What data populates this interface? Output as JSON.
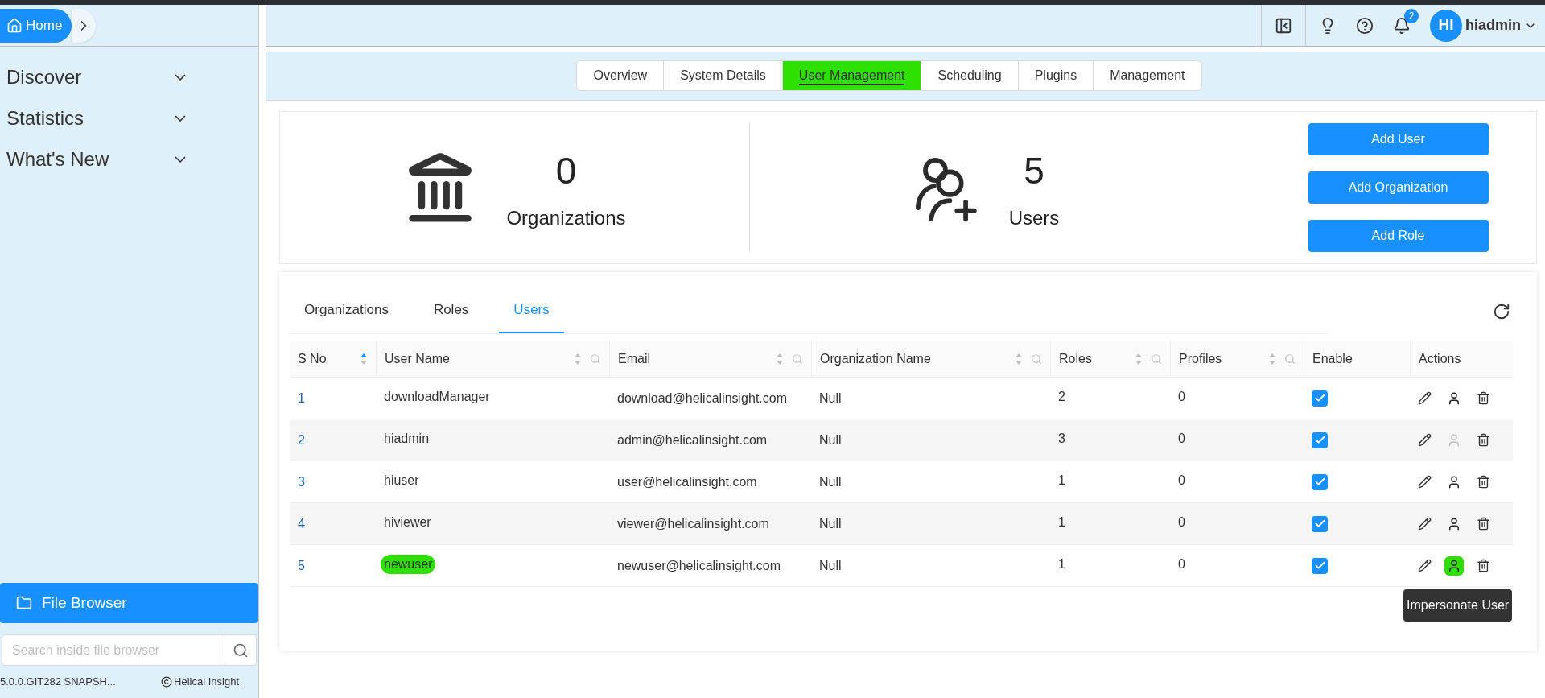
{
  "sidebar": {
    "home": "Home",
    "menu": [
      {
        "label": "Discover",
        "expanded": false
      },
      {
        "label": "Statistics",
        "expanded": false
      },
      {
        "label": "What's New",
        "expanded": false
      }
    ],
    "file_browser": "File Browser",
    "search": {
      "placeholder": "Search inside file browser"
    },
    "version": "5.0.0.GIT282 SNAPSH...",
    "copyright": "Helical Insight"
  },
  "header": {
    "notifications": "2",
    "avatar": "HI",
    "user": "hiadmin"
  },
  "nav_tabs": [
    {
      "label": "Overview",
      "selected": false,
      "highlighted": false
    },
    {
      "label": "System Details",
      "selected": false,
      "highlighted": false
    },
    {
      "label": "User Management",
      "selected": true,
      "highlighted": true
    },
    {
      "label": "Scheduling",
      "selected": false,
      "highlighted": false
    },
    {
      "label": "Plugins",
      "selected": false,
      "highlighted": false
    },
    {
      "label": "Management",
      "selected": false,
      "highlighted": false
    }
  ],
  "stats": [
    {
      "kind": "organizations",
      "count": "0",
      "label": "Organizations"
    },
    {
      "kind": "users",
      "count": "5",
      "label": "Users"
    }
  ],
  "buttons": [
    "Add User",
    "Add Organization",
    "Add Role"
  ],
  "sub_tabs": [
    {
      "label": "Organizations",
      "selected": false
    },
    {
      "label": "Roles",
      "selected": false
    },
    {
      "label": "Users",
      "selected": true
    }
  ],
  "table": {
    "columns": [
      {
        "label": "S No",
        "sorted": true
      },
      {
        "label": "User Name",
        "sorted": false,
        "filter": true
      },
      {
        "label": "Email",
        "sorted": false,
        "filter": true
      },
      {
        "label": "Organization Name",
        "sorted": false,
        "filter": true
      },
      {
        "label": "Roles",
        "sorted": false,
        "filter": true
      },
      {
        "label": "Profiles",
        "sorted": false,
        "filter": true
      },
      {
        "label": "Enable"
      },
      {
        "label": "Actions"
      }
    ],
    "rows": [
      {
        "sno": "1",
        "user_name": "downloadManager",
        "email": "download@helicalinsight.com",
        "organization": "Null",
        "roles": "2",
        "profiles": "0",
        "enabled": true,
        "impersonate_disabled": false,
        "highlighted": false
      },
      {
        "sno": "2",
        "user_name": "hiadmin",
        "email": "admin@helicalinsight.com",
        "organization": "Null",
        "roles": "3",
        "profiles": "0",
        "enabled": true,
        "impersonate_disabled": true,
        "highlighted": false
      },
      {
        "sno": "3",
        "user_name": "hiuser",
        "email": "user@helicalinsight.com",
        "organization": "Null",
        "roles": "1",
        "profiles": "0",
        "enabled": true,
        "impersonate_disabled": false,
        "highlighted": false
      },
      {
        "sno": "4",
        "user_name": "hiviewer",
        "email": "viewer@helicalinsight.com",
        "organization": "Null",
        "roles": "1",
        "profiles": "0",
        "enabled": true,
        "impersonate_disabled": false,
        "highlighted": false
      },
      {
        "sno": "5",
        "user_name": "newuser",
        "email": "newuser@helicalinsight.com",
        "organization": "Null",
        "roles": "1",
        "profiles": "0",
        "enabled": true,
        "impersonate_disabled": false,
        "highlighted": true
      }
    ]
  },
  "tooltip": "Impersonate User"
}
